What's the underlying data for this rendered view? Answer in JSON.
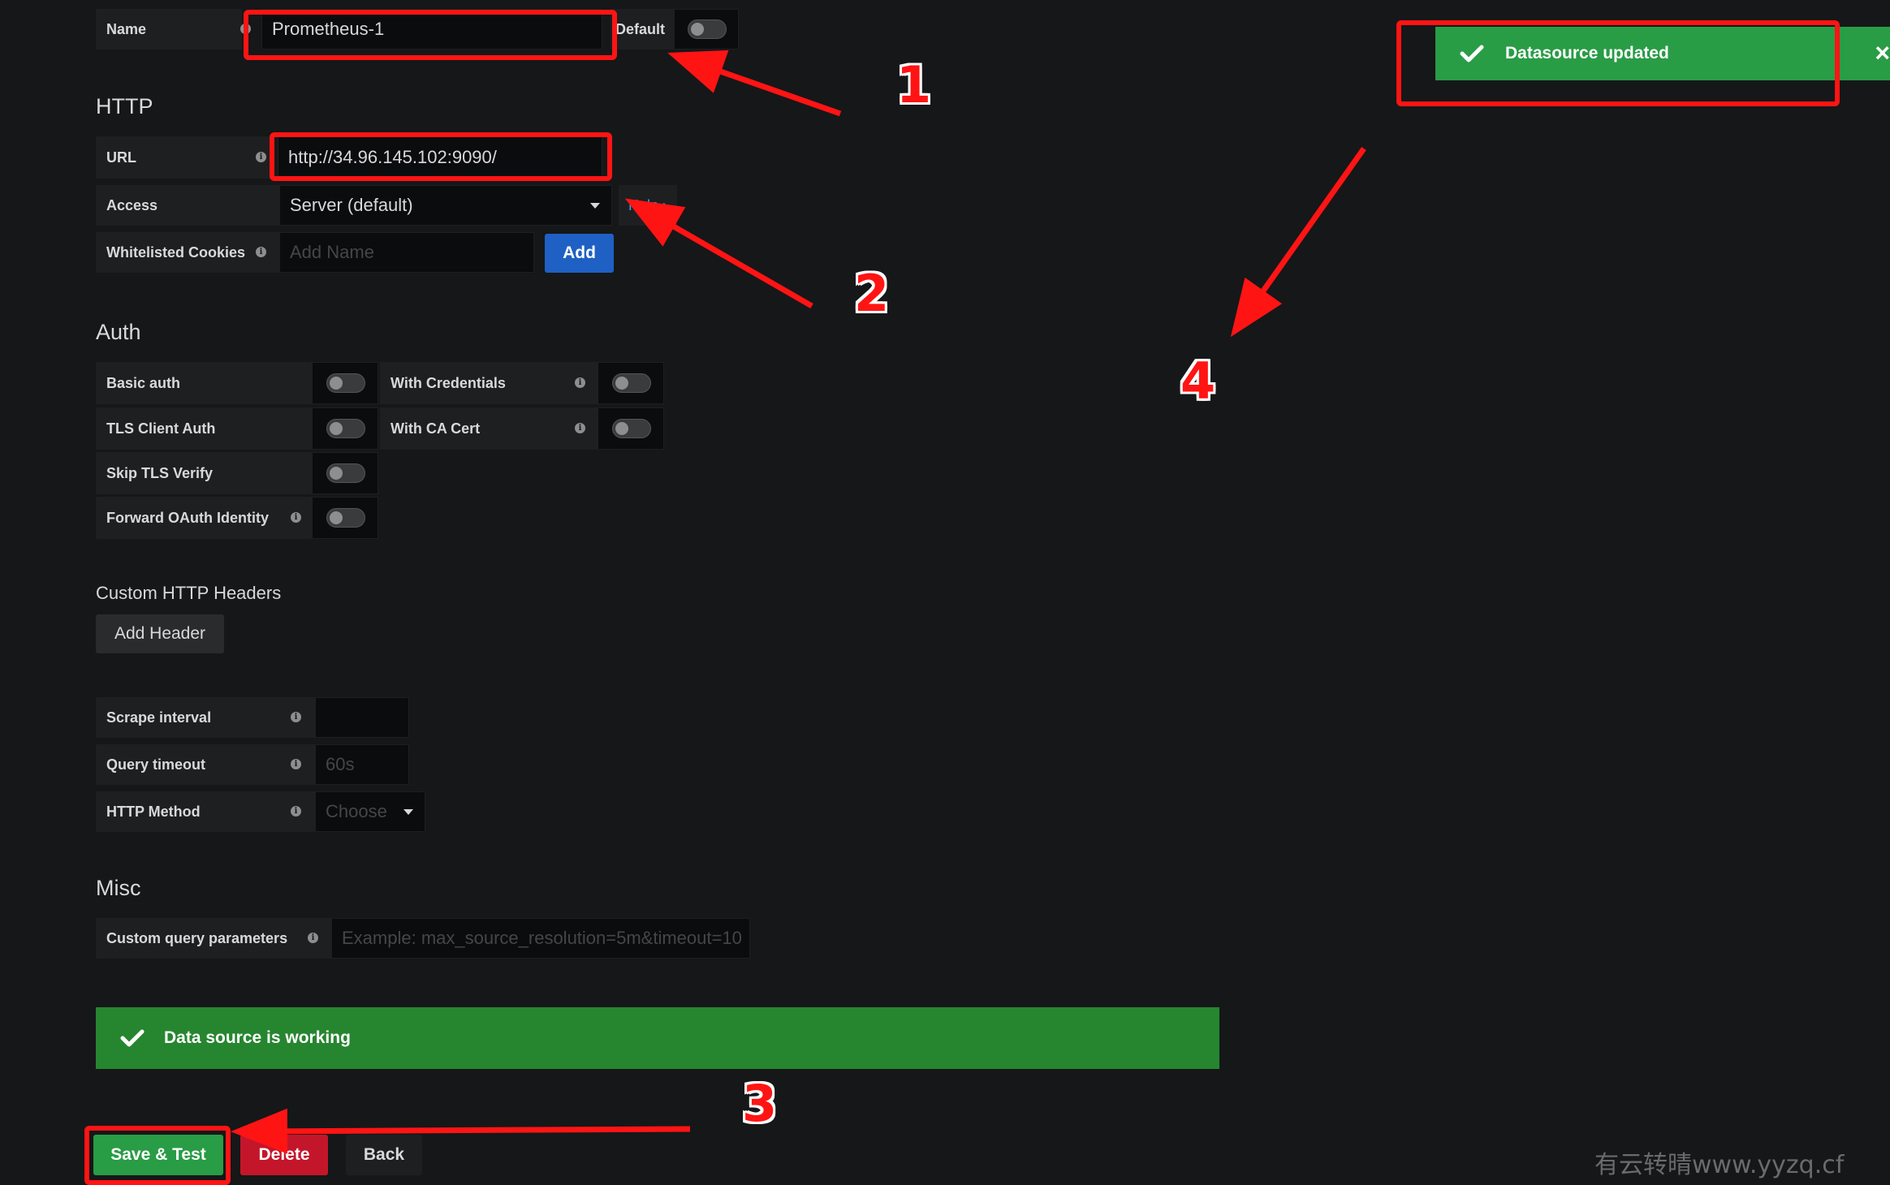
{
  "name_row": {
    "label": "Name",
    "value": "Prometheus-1",
    "default_label": "Default"
  },
  "http": {
    "heading": "HTTP",
    "url_label": "URL",
    "url_value": "http://34.96.145.102:9090/",
    "access_label": "Access",
    "access_value": "Server (default)",
    "help_label": "Help ›",
    "cookies_label": "Whitelisted Cookies",
    "cookies_placeholder": "Add Name",
    "add_button": "Add"
  },
  "auth": {
    "heading": "Auth",
    "basic_auth": "Basic auth",
    "with_credentials": "With Credentials",
    "tls_client_auth": "TLS Client Auth",
    "with_ca_cert": "With CA Cert",
    "skip_tls_verify": "Skip TLS Verify",
    "forward_oauth": "Forward OAuth Identity"
  },
  "custom_headers": {
    "heading": "Custom HTTP Headers",
    "add_header_button": "Add Header"
  },
  "prometheus": {
    "scrape_interval_label": "Scrape interval",
    "scrape_interval_value": "",
    "query_timeout_label": "Query timeout",
    "query_timeout_placeholder": "60s",
    "http_method_label": "HTTP Method",
    "http_method_placeholder": "Choose"
  },
  "misc": {
    "heading": "Misc",
    "custom_query_label": "Custom query parameters",
    "custom_query_placeholder": "Example: max_source_resolution=5m&timeout=10"
  },
  "status": {
    "message": "Data source is working"
  },
  "actions": {
    "save_test": "Save & Test",
    "delete": "Delete",
    "back": "Back"
  },
  "toast": {
    "message": "Datasource updated",
    "close": "×"
  },
  "annotations": {
    "n1": "1",
    "n2": "2",
    "n3": "3",
    "n4": "4"
  },
  "watermark": "有云转晴www.yyzq.cf",
  "colors": {
    "background": "#161719",
    "label_bg": "#1e1f21",
    "input_bg": "#0b0c0e",
    "success_green": "#299c46",
    "primary_blue": "#1f60c4",
    "danger_red": "#d44a3a",
    "annotation_red": "#ff1414"
  }
}
